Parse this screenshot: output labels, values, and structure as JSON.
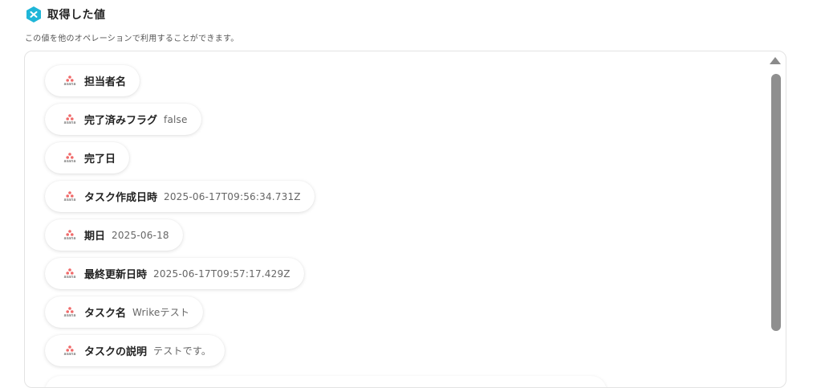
{
  "header": {
    "title": "取得した値",
    "subtitle": "この値を他のオペレーションで利用することができます。",
    "icon_color": "#1fb6d8"
  },
  "app_logo": {
    "name": "asana",
    "color": "#f06a6a"
  },
  "items": [
    {
      "label": "担当者名",
      "value": ""
    },
    {
      "label": "完了済みフラグ",
      "value": "false"
    },
    {
      "label": "完了日",
      "value": ""
    },
    {
      "label": "タスク作成日時",
      "value": "2025-06-17T09:56:34.731Z"
    },
    {
      "label": "期日",
      "value": "2025-06-18"
    },
    {
      "label": "最終更新日時",
      "value": "2025-06-17T09:57:17.429Z"
    },
    {
      "label": "タスク名",
      "value": "Wrikeテスト"
    },
    {
      "label": "タスクの説明",
      "value": "テストです。"
    }
  ]
}
